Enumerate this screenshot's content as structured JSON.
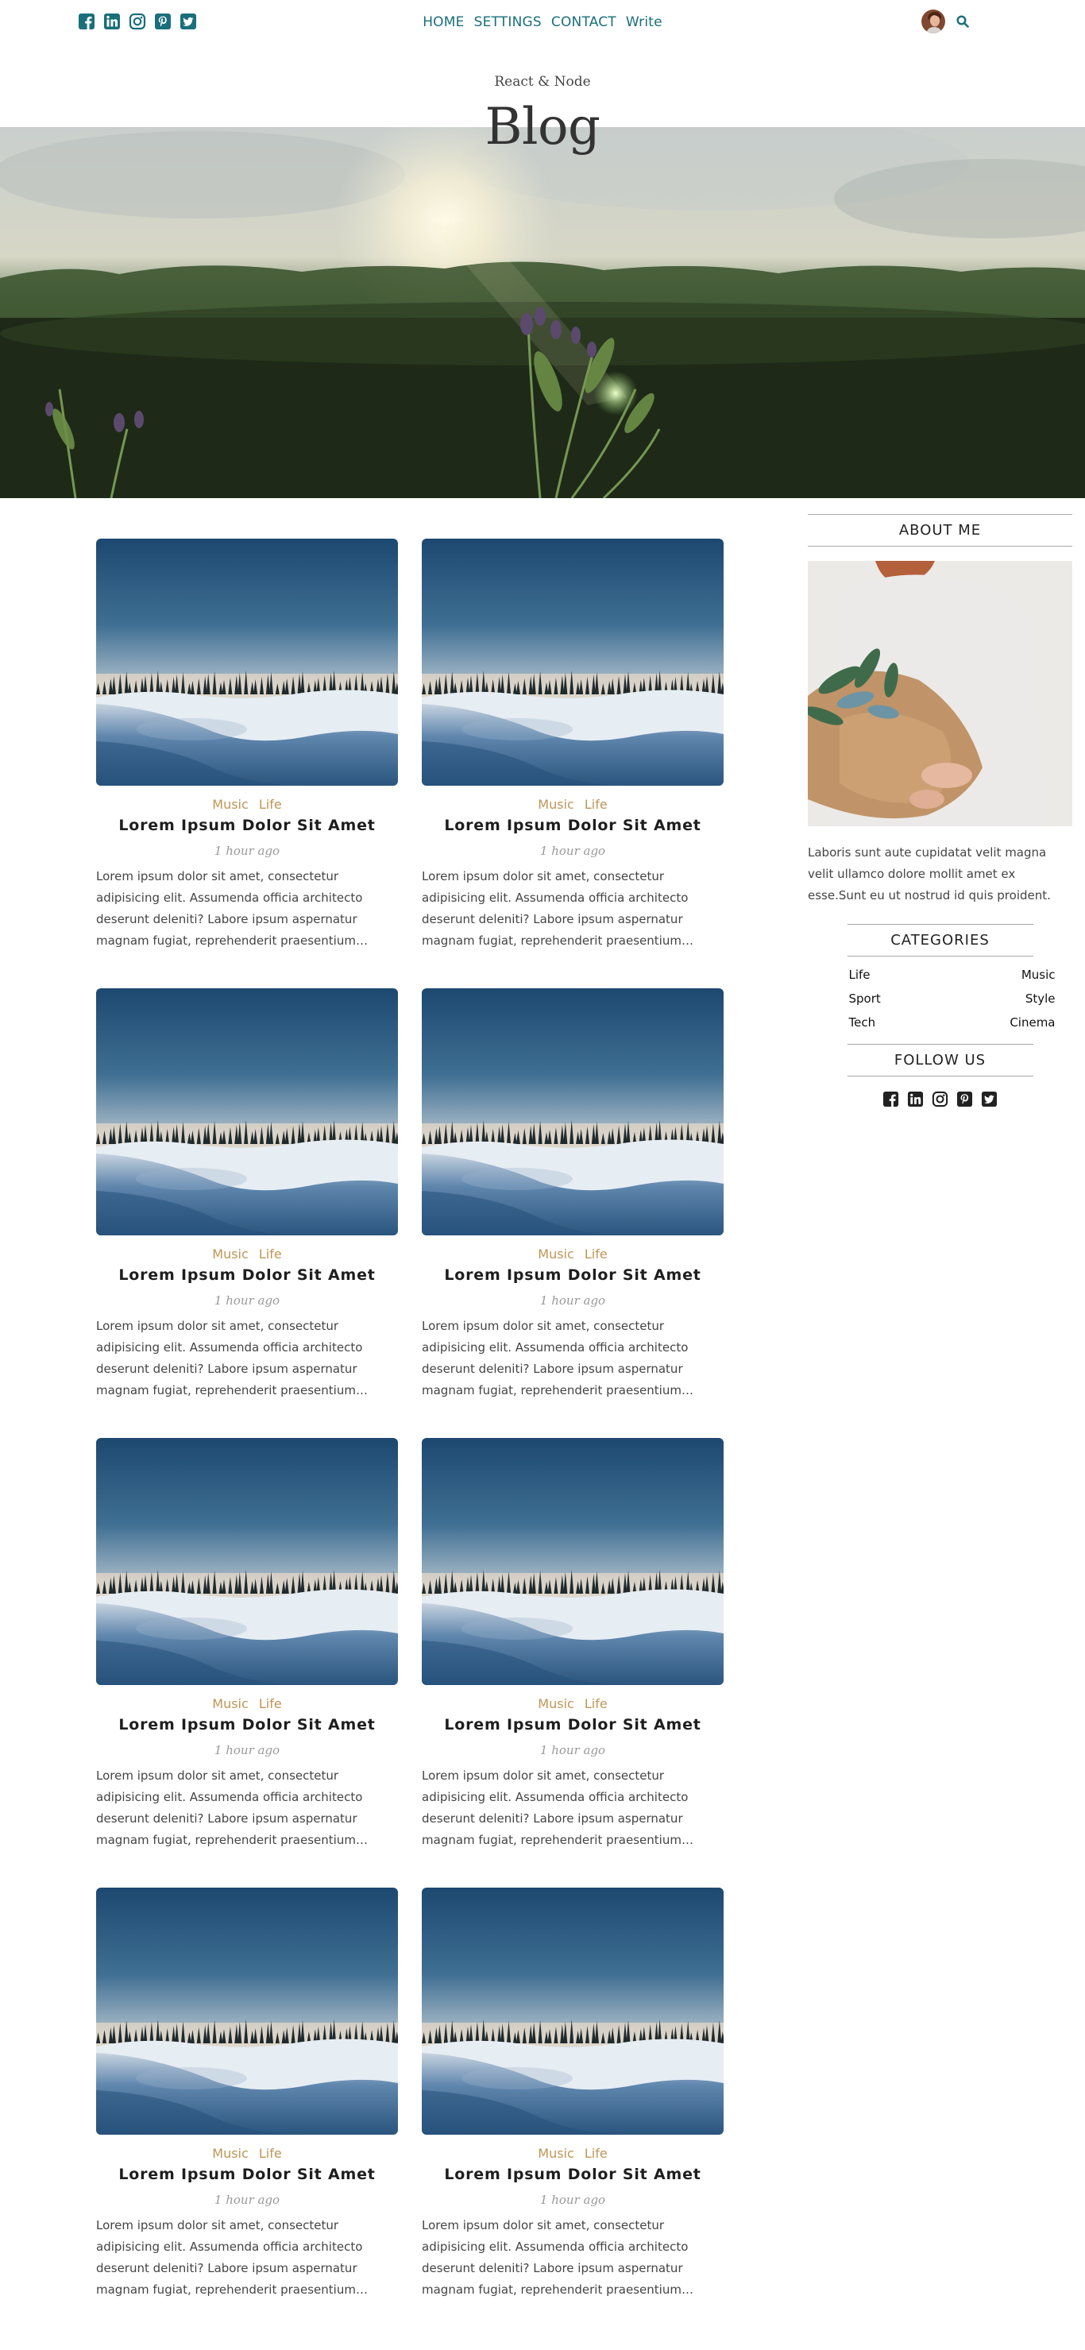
{
  "topbar": {
    "social_icons": [
      "facebook-square-icon",
      "linkedin-icon",
      "instagram-icon",
      "pinterest-icon",
      "twitter-square-icon"
    ],
    "nav": [
      {
        "label": "HOME"
      },
      {
        "label": "SETTINGS"
      },
      {
        "label": "CONTACT"
      },
      {
        "label": "Write"
      }
    ],
    "search_icon": "search-icon",
    "accent_color": "#1a6f7a"
  },
  "header": {
    "subtitle": "React & Node",
    "title": "Blog"
  },
  "posts": [
    {
      "cats": [
        "Music",
        "Life"
      ],
      "title": "Lorem Ipsum Dolor Sit Amet",
      "date": "1 hour ago",
      "desc": "Lorem ipsum dolor sit amet, consectetur adipisicing elit. Assumenda officia architecto deserunt deleniti? Labore ipsum aspernatur magnam fugiat, reprehenderit praesentium eligendi quis architecto enim."
    },
    {
      "cats": [
        "Music",
        "Life"
      ],
      "title": "Lorem Ipsum Dolor Sit Amet",
      "date": "1 hour ago",
      "desc": "Lorem ipsum dolor sit amet, consectetur adipisicing elit. Assumenda officia architecto deserunt deleniti? Labore ipsum aspernatur magnam fugiat, reprehenderit praesentium eligendi quis architecto enim."
    },
    {
      "cats": [
        "Music",
        "Life"
      ],
      "title": "Lorem Ipsum Dolor Sit Amet",
      "date": "1 hour ago",
      "desc": "Lorem ipsum dolor sit amet, consectetur adipisicing elit. Assumenda officia architecto deserunt deleniti? Labore ipsum aspernatur magnam fugiat, reprehenderit praesentium eligendi quis architecto enim."
    },
    {
      "cats": [
        "Music",
        "Life"
      ],
      "title": "Lorem Ipsum Dolor Sit Amet",
      "date": "1 hour ago",
      "desc": "Lorem ipsum dolor sit amet, consectetur adipisicing elit. Assumenda officia architecto deserunt deleniti? Labore ipsum aspernatur magnam fugiat, reprehenderit praesentium eligendi quis architecto enim."
    },
    {
      "cats": [
        "Music",
        "Life"
      ],
      "title": "Lorem Ipsum Dolor Sit Amet",
      "date": "1 hour ago",
      "desc": "Lorem ipsum dolor sit amet, consectetur adipisicing elit. Assumenda officia architecto deserunt deleniti? Labore ipsum aspernatur magnam fugiat, reprehenderit praesentium eligendi quis architecto enim."
    },
    {
      "cats": [
        "Music",
        "Life"
      ],
      "title": "Lorem Ipsum Dolor Sit Amet",
      "date": "1 hour ago",
      "desc": "Lorem ipsum dolor sit amet, consectetur adipisicing elit. Assumenda officia architecto deserunt deleniti? Labore ipsum aspernatur magnam fugiat, reprehenderit praesentium eligendi quis architecto enim."
    },
    {
      "cats": [
        "Music",
        "Life"
      ],
      "title": "Lorem Ipsum Dolor Sit Amet",
      "date": "1 hour ago",
      "desc": "Lorem ipsum dolor sit amet, consectetur adipisicing elit. Assumenda officia architecto deserunt deleniti? Labore ipsum aspernatur magnam fugiat, reprehenderit praesentium eligendi quis architecto enim."
    },
    {
      "cats": [
        "Music",
        "Life"
      ],
      "title": "Lorem Ipsum Dolor Sit Amet",
      "date": "1 hour ago",
      "desc": "Lorem ipsum dolor sit amet, consectetur adipisicing elit. Assumenda officia architecto deserunt deleniti? Labore ipsum aspernatur magnam fugiat, reprehenderit praesentium eligendi quis architecto enim."
    }
  ],
  "sidebar": {
    "about_title": "ABOUT ME",
    "about_text": "Laboris sunt aute cupidatat velit magna velit ullamco dolore mollit amet ex esse.Sunt eu ut nostrud id quis proident.",
    "categories_title": "CATEGORIES",
    "categories": [
      "Life",
      "Music",
      "Sport",
      "Style",
      "Tech",
      "Cinema"
    ],
    "follow_title": "FOLLOW US",
    "follow_icons": [
      "facebook-square-icon",
      "linkedin-icon",
      "instagram-icon",
      "pinterest-icon",
      "twitter-square-icon"
    ],
    "category_color": "#be9656"
  }
}
